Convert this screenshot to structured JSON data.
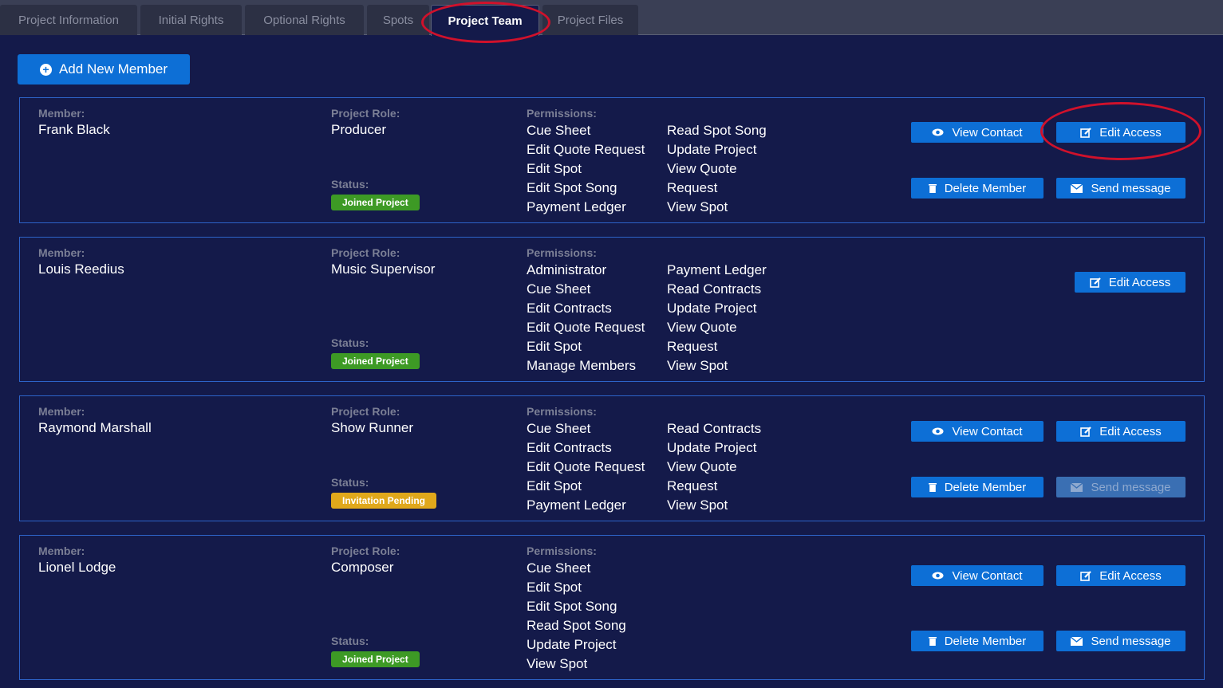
{
  "tabs": [
    {
      "label": "Project Information"
    },
    {
      "label": "Initial Rights"
    },
    {
      "label": "Optional Rights"
    },
    {
      "label": "Spots"
    },
    {
      "label": "Project Team"
    },
    {
      "label": "Project Files"
    }
  ],
  "add_member_label": "Add New Member",
  "labels": {
    "member": "Member:",
    "role": "Project Role:",
    "permissions": "Permissions:",
    "status": "Status:"
  },
  "actions": {
    "view_contact": "View Contact",
    "edit_access": "Edit Access",
    "delete_member": "Delete Member",
    "send_message": "Send message"
  },
  "colors": {
    "accent": "#0d6fd6",
    "joined": "#3d9a25",
    "pending": "#e0a81b",
    "highlight_ring": "#d0112b"
  },
  "members": [
    {
      "name": "Frank Black",
      "role": "Producer",
      "status": "Joined Project",
      "permissions_col1": [
        "Cue Sheet",
        "Edit Quote Request",
        "Edit Spot",
        "Edit Spot Song",
        "Payment Ledger"
      ],
      "permissions_col2": [
        "Read Spot Song",
        "Update Project",
        "View Quote",
        "Request",
        "View Spot"
      ]
    },
    {
      "name": "Louis Reedius",
      "role": "Music Supervisor",
      "status": "Joined Project",
      "permissions_col1": [
        "Administrator",
        "Cue Sheet",
        "Edit Contracts",
        "Edit Quote Request",
        "Edit Spot",
        "Manage Members"
      ],
      "permissions_col2": [
        "Payment Ledger",
        "Read Contracts",
        "Update Project",
        "View Quote",
        "Request",
        "View Spot"
      ]
    },
    {
      "name": "Raymond Marshall",
      "role": "Show Runner",
      "status": "Invitation Pending",
      "permissions_col1": [
        "Cue Sheet",
        "Edit Contracts",
        "Edit Quote Request",
        "Edit Spot",
        "Payment Ledger"
      ],
      "permissions_col2": [
        "Read Contracts",
        "Update Project",
        "View Quote",
        "Request",
        "View Spot"
      ]
    },
    {
      "name": "Lionel Lodge",
      "role": "Composer",
      "status": "Joined Project",
      "permissions_col1": [
        "Cue Sheet",
        "Edit Spot",
        "Edit Spot Song",
        "Read Spot Song",
        "Update Project",
        "View Spot"
      ],
      "permissions_col2": []
    }
  ]
}
